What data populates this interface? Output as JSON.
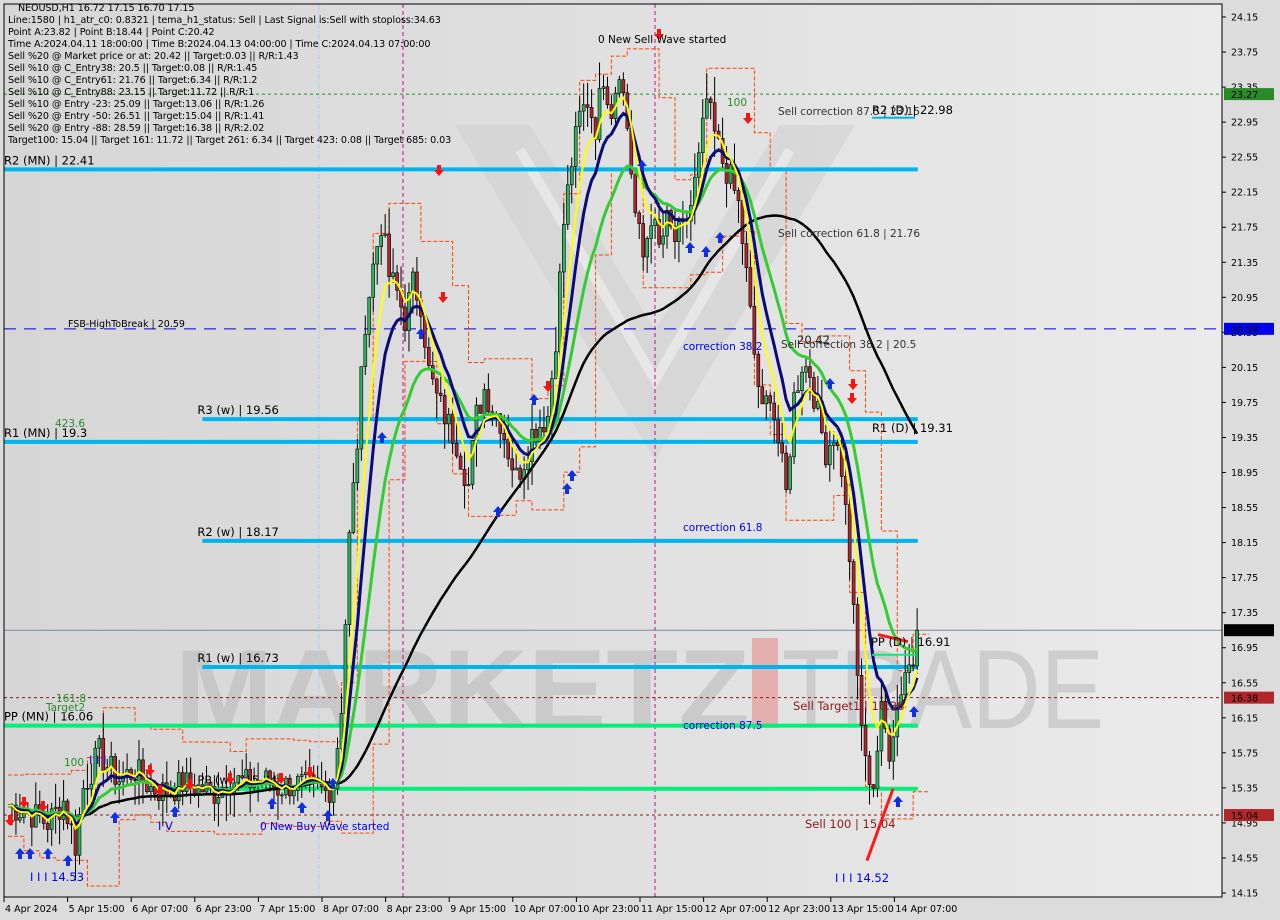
{
  "header": {
    "symbol_line": "NEOUSD,H1  16.72 17.15 16.70 17.15",
    "info_lines": [
      "Line:1580 | h1_atr_c0: 0.8321 | tema_h1_status: Sell | Last Signal is:Sell with stoploss:34.63",
      "Point A:23.82 | Point B:18.44 | Point C:20.42",
      "Time A:2024.04.11 18:00:00 | Time B:2024.04.13 04:00:00 | Time C:2024.04.13 07:00:00",
      "Sell %20 @ Market price or at: 20.42 || Target:0.03 || R/R:1.43",
      "Sell %10 @ C_Entry38: 20.5 || Target:0.08 || R/R:1.45",
      "Sell %10 @ C_Entry61: 21.76 || Target:6.34 || R/R:1.2",
      "Sell %10 @ C_Entry88: 23.15 || Target:11.72 || R/R:1",
      "Sell %10 @ Entry -23: 25.09 || Target:13.06 || R/R:1.26",
      "Sell %20 @ Entry -50: 26.51 || Target:15.04 || R/R:1.41",
      "Sell %20 @ Entry -88: 28.59 || Target:16.38 || R/R:2.02",
      "Target100: 15.04 || Target 161: 11.72 || Target 261: 6.34 || Target 423: 0.08 || Target 685: 0.03"
    ]
  },
  "watermark": {
    "left": "MARKETZ",
    "right": "TRADE"
  },
  "colors": {
    "background": "#dcdcdc",
    "bull_candle": "#2db55d",
    "bear_candle": "#b0262b",
    "pivot_blue": "#00b4f0",
    "pivot_green": "#00f07a",
    "fsb_line": "#0000dd",
    "target_line": "#8b1a1a",
    "upper_green_line": "#2a8a2a",
    "current_price": "#000000",
    "ma_yellow": "#ffff00",
    "ma_navy": "#0a0a78",
    "ma_green": "#33cc33",
    "ma_black": "#000000",
    "channel_orange": "#ff4400",
    "signal_up": "#1030e0",
    "signal_down": "#ff1010",
    "session_magenta": "#c0108f"
  },
  "chart_data": {
    "type": "candlestick",
    "title": "NEOUSD,H1",
    "ohlc_last": {
      "open": 16.72,
      "high": 17.15,
      "low": 16.7,
      "close": 17.15
    },
    "ylim": [
      14.15,
      24.15
    ],
    "y_ticks": [
      "24.15",
      "23.75",
      "23.35",
      "22.95",
      "22.55",
      "22.15",
      "21.75",
      "21.35",
      "20.95",
      "20.55",
      "20.15",
      "19.75",
      "19.35",
      "18.95",
      "18.55",
      "18.15",
      "17.75",
      "17.35",
      "16.95",
      "16.55",
      "16.15",
      "15.75",
      "15.35",
      "14.95",
      "14.55",
      "14.15"
    ],
    "x_ticks": [
      "4 Apr 2024",
      "5 Apr 15:00",
      "6 Apr 07:00",
      "6 Apr 23:00",
      "7 Apr 15:00",
      "8 Apr 07:00",
      "8 Apr 23:00",
      "9 Apr 15:00",
      "10 Apr 07:00",
      "10 Apr 23:00",
      "11 Apr 15:00",
      "12 Apr 07:00",
      "12 Apr 23:00",
      "13 Apr 15:00",
      "14 Apr 07:00"
    ],
    "price_tags": [
      {
        "value": 23.27,
        "label": "23.27",
        "bg": "#2a8a2a",
        "fg": "#ffffff"
      },
      {
        "value": 20.59,
        "label": "20.59",
        "bg": "#0000ee",
        "fg": "#ffffff"
      },
      {
        "value": 17.15,
        "label": "17.15",
        "bg": "#000000",
        "fg": "#ffffff"
      },
      {
        "value": 16.38,
        "label": "16.38",
        "bg": "#b0262b",
        "fg": "#ffffff"
      },
      {
        "value": 15.04,
        "label": "15.04",
        "bg": "#b0262b",
        "fg": "#ffffff"
      }
    ],
    "levels": [
      {
        "name": "R2 (MN)",
        "value": 22.41,
        "label": "R2 (MN) | 22.41",
        "kind": "pivot-blue",
        "from": 0.0,
        "to": 0.717
      },
      {
        "name": "R3 (w)",
        "value": 19.56,
        "label": "R3 (w) | 19.56",
        "kind": "pivot-blue",
        "from": 0.155,
        "to": 0.717
      },
      {
        "name": "R1 (MN)",
        "value": 19.3,
        "label": "R1 (MN) | 19.3",
        "kind": "pivot-blue",
        "from": 0.0,
        "to": 0.717
      },
      {
        "name": "R2 (w)",
        "value": 18.17,
        "label": "R2 (w) | 18.17",
        "kind": "pivot-blue",
        "from": 0.155,
        "to": 0.717
      },
      {
        "name": "R1 (w)",
        "value": 16.73,
        "label": "R1 (w) | 16.73",
        "kind": "pivot-blue",
        "from": 0.155,
        "to": 0.717
      },
      {
        "name": "PP (MN)",
        "value": 16.06,
        "label": "PP (MN) | 16.06",
        "kind": "pivot-green",
        "from": 0.0,
        "to": 0.717
      },
      {
        "name": "PP (w)",
        "value": 15.34,
        "label": "PP (w) | 15.34",
        "kind": "pivot-green",
        "from": 0.155,
        "to": 0.717
      }
    ],
    "annotations": [
      {
        "text": "FSB-HighToBreak | 20.59",
        "value": 20.59
      },
      {
        "text": "0 New Sell Wave started",
        "value": 23.95
      },
      {
        "text": "Sell correction 87.5 | 23.15",
        "value": 22.98
      },
      {
        "text": "R2 (D) | 22.98",
        "value": 22.98
      },
      {
        "text": "Sell correction 61.8 | 21.76",
        "value": 21.76
      },
      {
        "text": "correction 38.2",
        "value": 20.45
      },
      {
        "text": "Sell correction 38.2 | 20.5",
        "value": 20.5
      },
      {
        "text": "20.42",
        "value": 20.5
      },
      {
        "text": "R1 (D) | 19.31",
        "value": 19.31
      },
      {
        "text": "correction 61.8",
        "value": 18.3
      },
      {
        "text": "PP (D) | 16.91",
        "value": 16.91
      },
      {
        "text": "Sell Target1 | 16.38",
        "value": 16.38
      },
      {
        "text": "correction 87.5",
        "value": 16.06
      },
      {
        "text": "Sell 100 | 15.04",
        "value": 15.04
      },
      {
        "text": "0 New Buy Wave started",
        "value": 15.05
      },
      {
        "text": "I I I 14.53",
        "value": 14.53
      },
      {
        "text": "I I I 14.52",
        "value": 14.52
      },
      {
        "text": "423.6",
        "value": 19.42
      },
      {
        "text": "161.8",
        "value": 16.43
      },
      {
        "text": "Target2",
        "value": 16.3
      },
      {
        "text": "100",
        "value": 15.65
      },
      {
        "text": "100",
        "value": 23.02
      },
      {
        "text": "I I I",
        "value": 15.72
      },
      {
        "text": "I V",
        "value": 15.1
      }
    ],
    "dashed_levels": [
      {
        "value": 23.27,
        "kind": "upper-green"
      },
      {
        "value": 20.59,
        "kind": "fsb"
      },
      {
        "value": 16.38,
        "kind": "target"
      },
      {
        "value": 15.04,
        "kind": "target"
      }
    ],
    "current_price": 17.15,
    "close_path": [
      [
        0,
        15.15
      ],
      [
        6,
        15.05
      ],
      [
        10,
        14.95
      ],
      [
        14,
        15.2
      ],
      [
        17,
        14.7
      ],
      [
        19,
        15.35
      ],
      [
        23,
        15.75
      ],
      [
        25,
        15.6
      ],
      [
        28,
        15.45
      ],
      [
        32,
        15.55
      ],
      [
        36,
        15.35
      ],
      [
        40,
        15.3
      ],
      [
        44,
        15.4
      ],
      [
        48,
        15.35
      ],
      [
        52,
        15.3
      ],
      [
        56,
        15.45
      ],
      [
        60,
        15.4
      ],
      [
        64,
        15.45
      ],
      [
        68,
        15.35
      ],
      [
        72,
        15.4
      ],
      [
        76,
        15.35
      ],
      [
        80,
        15.3
      ],
      [
        82,
        15.4
      ],
      [
        84,
        16.3
      ],
      [
        86,
        18.2
      ],
      [
        88,
        19.3
      ],
      [
        90,
        20.7
      ],
      [
        92,
        21.3
      ],
      [
        94,
        21.8
      ],
      [
        96,
        21.2
      ],
      [
        98,
        21.0
      ],
      [
        100,
        20.7
      ],
      [
        102,
        21.1
      ],
      [
        104,
        20.9
      ],
      [
        106,
        20.1
      ],
      [
        108,
        19.8
      ],
      [
        110,
        19.6
      ],
      [
        113,
        19.3
      ],
      [
        116,
        18.8
      ],
      [
        118,
        19.6
      ],
      [
        120,
        19.9
      ],
      [
        122,
        19.7
      ],
      [
        124,
        19.55
      ],
      [
        126,
        19.2
      ],
      [
        128,
        18.9
      ],
      [
        130,
        19.1
      ],
      [
        132,
        19.4
      ],
      [
        134,
        19.5
      ],
      [
        136,
        19.6
      ],
      [
        138,
        20.5
      ],
      [
        140,
        21.8
      ],
      [
        142,
        22.5
      ],
      [
        144,
        23.0
      ],
      [
        146,
        23.2
      ],
      [
        148,
        22.9
      ],
      [
        150,
        23.5
      ],
      [
        152,
        23.1
      ],
      [
        154,
        23.6
      ],
      [
        156,
        22.9
      ],
      [
        158,
        21.9
      ],
      [
        160,
        21.4
      ],
      [
        162,
        21.9
      ],
      [
        164,
        21.5
      ],
      [
        166,
        21.8
      ],
      [
        168,
        21.6
      ],
      [
        170,
        21.7
      ],
      [
        172,
        22.0
      ],
      [
        174,
        22.5
      ],
      [
        176,
        23.2
      ],
      [
        178,
        22.8
      ],
      [
        180,
        22.5
      ],
      [
        182,
        22.3
      ],
      [
        184,
        22.0
      ],
      [
        186,
        21.2
      ],
      [
        188,
        20.3
      ],
      [
        190,
        19.6
      ],
      [
        192,
        19.9
      ],
      [
        194,
        19.3
      ],
      [
        196,
        18.7
      ],
      [
        198,
        19.8
      ],
      [
        200,
        20.2
      ],
      [
        202,
        20.1
      ],
      [
        204,
        19.6
      ],
      [
        206,
        19.2
      ],
      [
        208,
        19.4
      ],
      [
        210,
        19.0
      ],
      [
        212,
        18.0
      ],
      [
        214,
        16.6
      ],
      [
        216,
        15.6
      ],
      [
        218,
        15.4
      ],
      [
        220,
        16.2
      ],
      [
        222,
        15.8
      ],
      [
        224,
        16.3
      ],
      [
        226,
        16.7
      ],
      [
        228,
        16.8
      ],
      [
        229,
        17.15
      ]
    ]
  }
}
